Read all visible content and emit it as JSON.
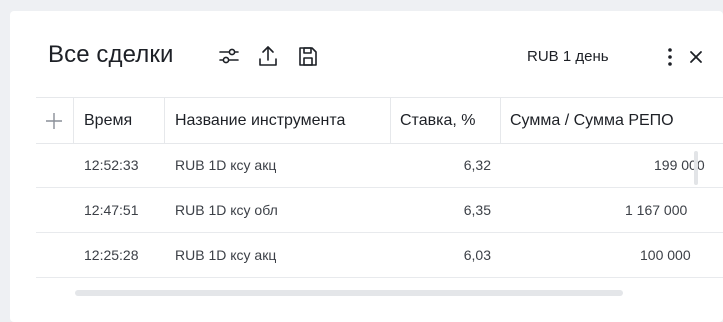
{
  "panel": {
    "title": "Все сделки",
    "period_label": "RUB 1 день",
    "icons": [
      "sliders-icon",
      "upload-icon",
      "save-icon",
      "more-vertical-icon",
      "close-icon"
    ]
  },
  "table": {
    "columns": [
      "Время",
      "Название инструмента",
      "Ставка, %",
      "Сумма / Сумма РЕПО"
    ],
    "rows": [
      {
        "time": "12:52:33",
        "instrument": "RUB 1D ксу акц",
        "rate": "6,32",
        "amount": "199 000"
      },
      {
        "time": "12:47:51",
        "instrument": "RUB 1D ксу обл",
        "rate": "6,35",
        "amount": "1 167 000"
      },
      {
        "time": "12:25:28",
        "instrument": "RUB 1D ксу акц",
        "rate": "6,03",
        "amount": "100 000"
      }
    ]
  },
  "colors": {
    "background": "#eef0f3",
    "panel": "#ffffff",
    "text": "#1d2026",
    "border": "#e6e8eb"
  }
}
